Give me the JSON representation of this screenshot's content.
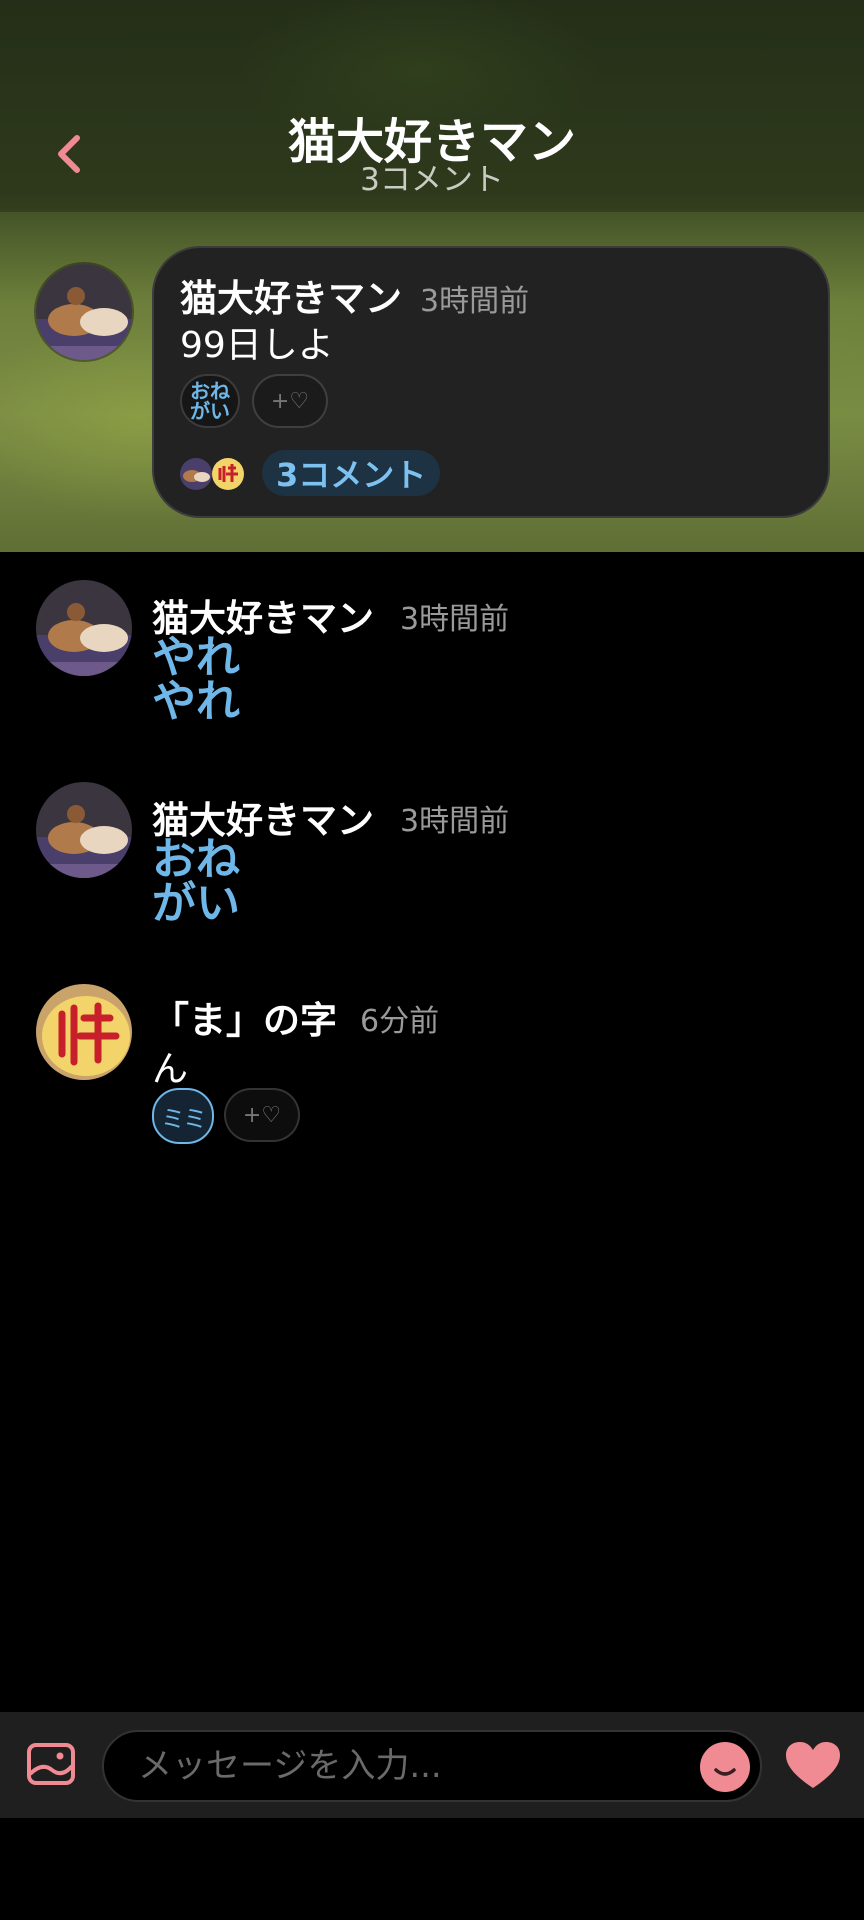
{
  "header": {
    "title": "猫大好きマン",
    "subtitle": "3コメント",
    "back_icon": "chevron-left-icon"
  },
  "post": {
    "author": "猫大好きマン",
    "time": "3時間前",
    "body": "99日しよ",
    "reaction_label": "おね\nがい",
    "add_reaction": "+♡",
    "comment_count": "3コメント"
  },
  "comments": [
    {
      "author": "猫大好きマン",
      "time": "3時間前",
      "text": "やれ\nやれ"
    },
    {
      "author": "猫大好きマン",
      "time": "3時間前",
      "text": "おね\nがい"
    },
    {
      "author": "「ま」の字",
      "time": "6分前",
      "text": "ん",
      "reaction_label": "ミミ",
      "add_reaction": "+♡"
    }
  ],
  "input": {
    "placeholder": "メッセージを入力..."
  },
  "colors": {
    "accent_pink": "#f08a93",
    "link_blue": "#6fb7e8",
    "card_bg": "#222222"
  }
}
